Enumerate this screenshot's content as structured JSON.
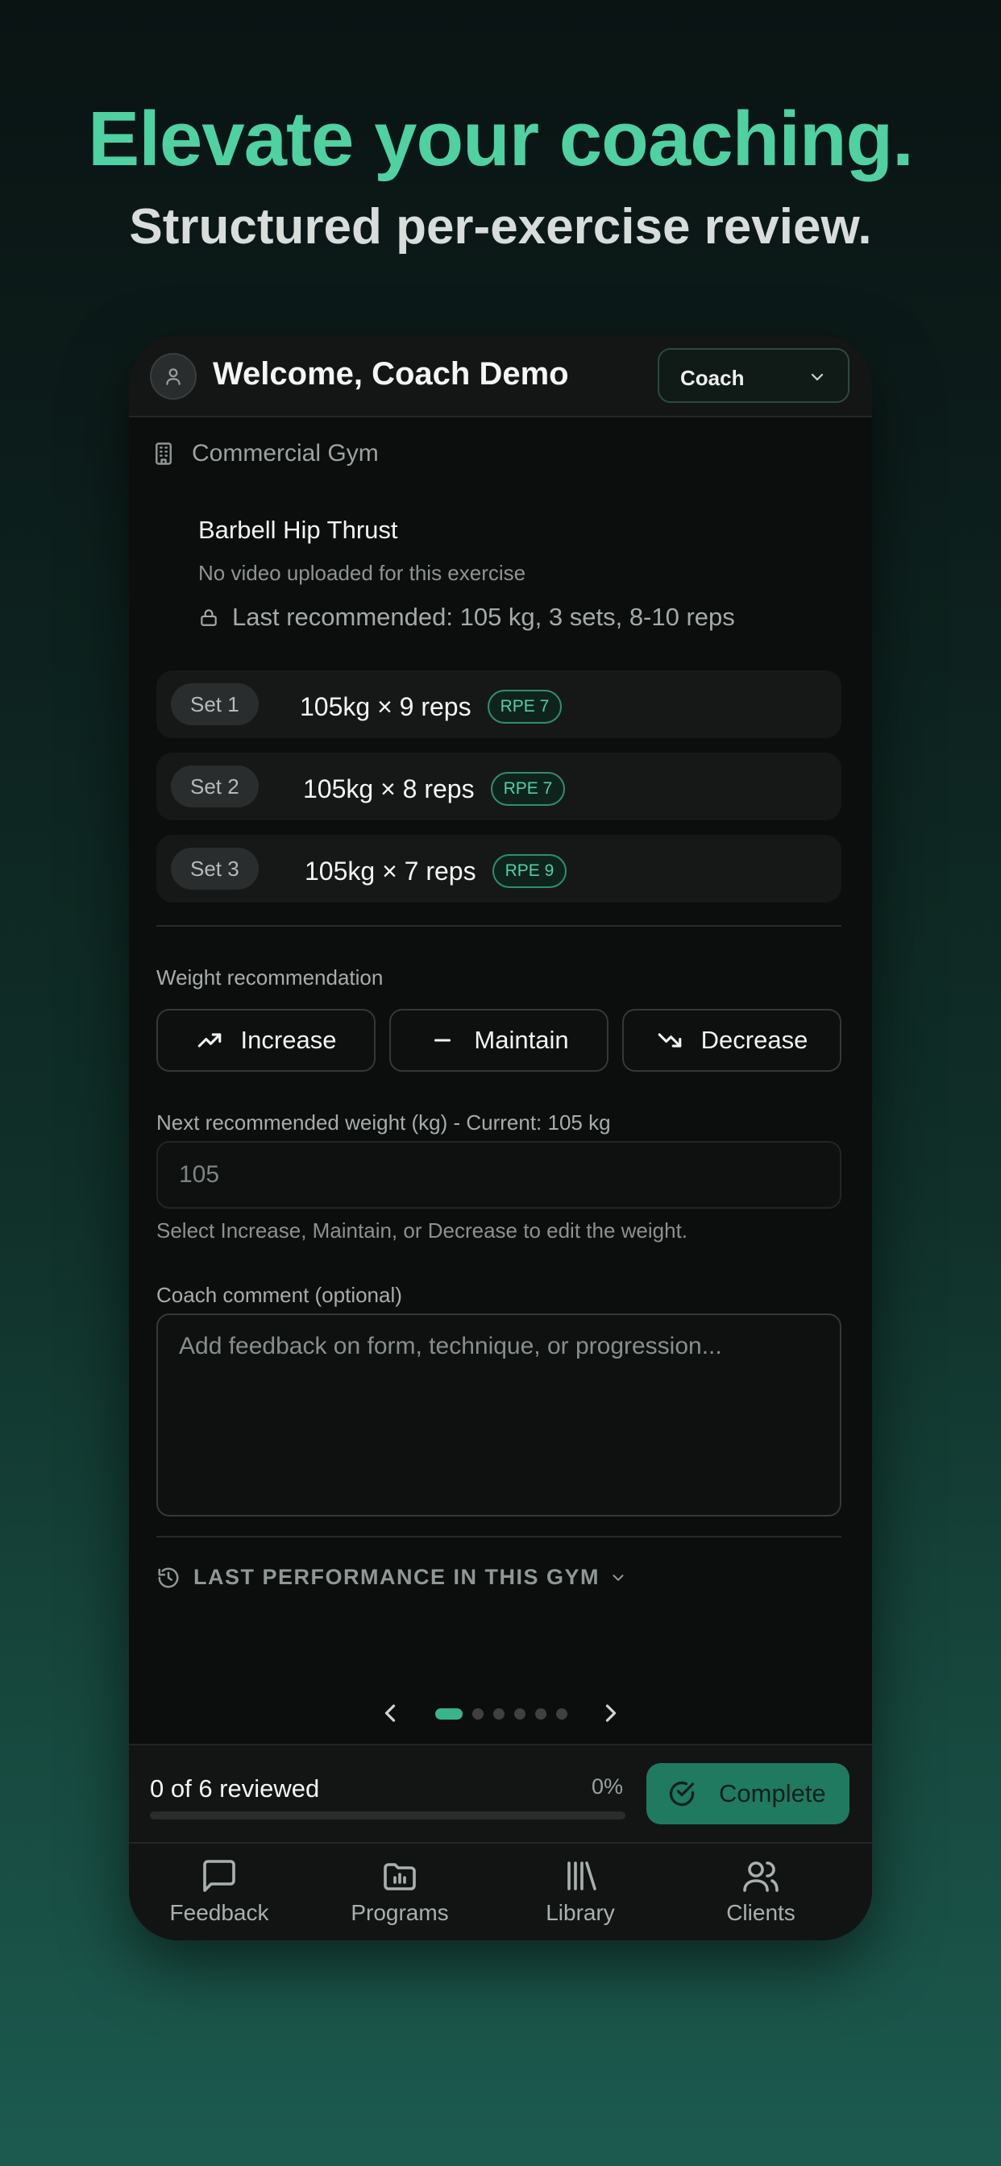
{
  "hero": {
    "title": "Elevate your coaching.",
    "subtitle": "Structured per-exercise review."
  },
  "header": {
    "welcome": "Welcome, Coach Demo",
    "role_selected": "Coach"
  },
  "gym": {
    "name": "Commercial Gym"
  },
  "exercise": {
    "name": "Barbell Hip Thrust",
    "video_status": "No video uploaded for this exercise",
    "last_recommended": "Last recommended: 105 kg, 3 sets, 8-10 reps"
  },
  "sets": [
    {
      "label": "Set 1",
      "detail": "105kg × 9 reps",
      "rpe": "RPE 7"
    },
    {
      "label": "Set 2",
      "detail": "105kg × 8 reps",
      "rpe": "RPE 7"
    },
    {
      "label": "Set 3",
      "detail": "105kg × 7 reps",
      "rpe": "RPE 9"
    }
  ],
  "recommendation": {
    "label": "Weight recommendation",
    "increase": "Increase",
    "maintain": "Maintain",
    "decrease": "Decrease"
  },
  "next_weight": {
    "label": "Next recommended weight (kg) - Current: 105 kg",
    "value": "105",
    "helper": "Select Increase, Maintain, or Decrease to edit the weight."
  },
  "comment": {
    "label": "Coach comment (optional)",
    "placeholder": "Add feedback on form, technique, or progression..."
  },
  "last_performance": {
    "label": "LAST PERFORMANCE IN THIS GYM"
  },
  "pager": {
    "total": 6,
    "active": 1
  },
  "review": {
    "status": "0 of 6 reviewed",
    "percent_label": "0%",
    "progress": 0,
    "complete_label": "Complete"
  },
  "tabs": [
    {
      "label": "Feedback",
      "icon": "message-square-icon"
    },
    {
      "label": "Programs",
      "icon": "folder-chart-icon"
    },
    {
      "label": "Library",
      "icon": "library-icon"
    },
    {
      "label": "Clients",
      "icon": "users-icon"
    }
  ],
  "colors": {
    "accent": "#4fd1a1",
    "complete_button": "#1f7a5f",
    "background": "#0c0d0d"
  }
}
